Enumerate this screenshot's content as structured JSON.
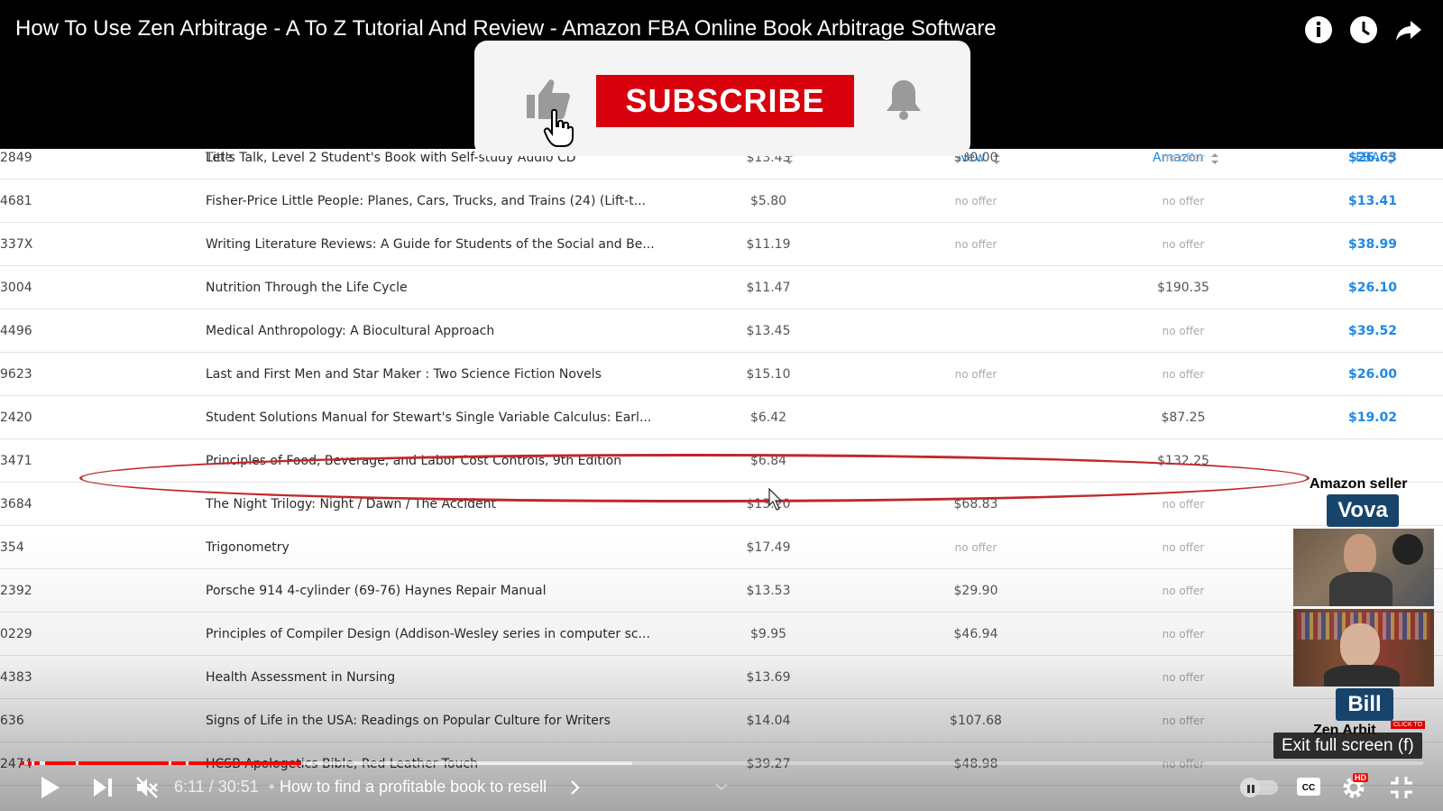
{
  "video": {
    "title": "How To Use Zen Arbitrage - A To Z Tutorial And Review - Amazon FBA Online Book Arbitrage Software"
  },
  "top_icons": [
    "info-icon",
    "watch-later-icon",
    "share-icon"
  ],
  "subscribe_overlay": {
    "button_label": "SUBSCRIBE",
    "icons": [
      "thumbs-up-icon",
      "pointer-hand-icon",
      "bell-icon"
    ]
  },
  "table": {
    "headers": {
      "title": "Title",
      "used": "Used",
      "new": "New",
      "amazon": "Amazon",
      "fba": "FBA"
    },
    "rows": [
      {
        "id": "2849",
        "title": "Let's Talk, Level 2 Student's Book with Self-study Audio CD",
        "used": "$13.43",
        "new": "$30.00",
        "amazon": "no offer",
        "fba": "$26.63"
      },
      {
        "id": "4681",
        "title": "Fisher-Price Little People: Planes, Cars, Trucks, and Trains (24) (Lift-t...",
        "used": "$5.80",
        "new": "no offer",
        "amazon": "no offer",
        "fba": "$13.41"
      },
      {
        "id": "337X",
        "title": "Writing Literature Reviews: A Guide for Students of the Social and Be...",
        "used": "$11.19",
        "new": "no offer",
        "amazon": "no offer",
        "fba": "$38.99"
      },
      {
        "id": "3004",
        "title": "Nutrition Through the Life Cycle",
        "used": "$11.47",
        "new": "",
        "amazon": "$190.35",
        "fba": "$26.10"
      },
      {
        "id": "4496",
        "title": "Medical Anthropology: A Biocultural Approach",
        "used": "$13.45",
        "new": "",
        "amazon": "no offer",
        "fba": "$39.52"
      },
      {
        "id": "9623",
        "title": "Last and First Men and Star Maker : Two Science Fiction Novels",
        "used": "$15.10",
        "new": "no offer",
        "amazon": "no offer",
        "fba": "$26.00"
      },
      {
        "id": "2420",
        "title": "Student Solutions Manual for Stewart's Single Variable Calculus: Earl...",
        "used": "$6.42",
        "new": "",
        "amazon": "$87.25",
        "fba": "$19.02"
      },
      {
        "id": "3471",
        "title": "Principles of Food, Beverage, and Labor Cost Controls, 9th Edition",
        "used": "$6.84",
        "new": "",
        "amazon": "$132.25",
        "fba": ""
      },
      {
        "id": "3684",
        "title": "The Night Trilogy: Night / Dawn / The Accident",
        "used": "$13.20",
        "new": "$68.83",
        "amazon": "no offer",
        "fba": ""
      },
      {
        "id": "354",
        "title": "Trigonometry",
        "used": "$17.49",
        "new": "no offer",
        "amazon": "no offer",
        "fba": ""
      },
      {
        "id": "2392",
        "title": "Porsche 914 4-cylinder (69-76) Haynes Repair Manual",
        "used": "$13.53",
        "new": "$29.90",
        "amazon": "no offer",
        "fba": ""
      },
      {
        "id": "0229",
        "title": "Principles of Compiler Design (Addison-Wesley series in computer sc...",
        "used": "$9.95",
        "new": "$46.94",
        "amazon": "no offer",
        "fba": ""
      },
      {
        "id": "4383",
        "title": "Health Assessment in Nursing",
        "used": "$13.69",
        "new": "",
        "amazon": "no offer",
        "fba": ""
      },
      {
        "id": "636",
        "title": "Signs of Life in the USA: Readings on Popular Culture for Writers",
        "used": "$14.04",
        "new": "$107.68",
        "amazon": "no offer",
        "fba": ""
      },
      {
        "id": "2474",
        "title": "HCSB Apologetics Bible, Red Leather Touch",
        "used": "$39.27",
        "new": "$48.98",
        "amazon": "no offer",
        "fba": ""
      }
    ]
  },
  "webcam": {
    "heading": "Amazon seller",
    "person1": "Vova",
    "person2": "Bill",
    "brand_partial": "Zen Arbit"
  },
  "player": {
    "time": "6:11 / 30:51",
    "chapter_separator": "•",
    "chapter": "How to find a profitable book to resell",
    "exit_fullscreen_tooltip": "Exit full screen (f)",
    "progress": 0.2,
    "hd_badge": "HD",
    "click_badge": "CLICK TO"
  }
}
